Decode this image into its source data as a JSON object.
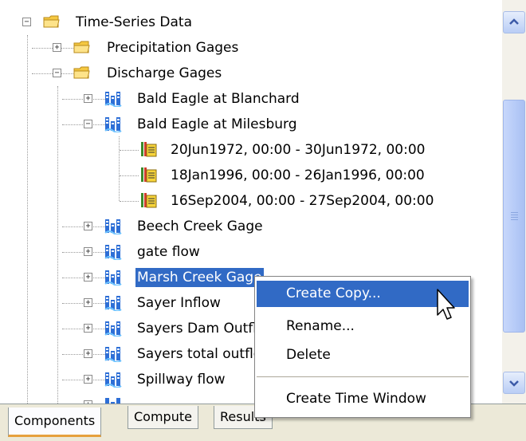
{
  "tree": {
    "root": {
      "label": "Time-Series Data",
      "expander": "−"
    },
    "precipitation": {
      "label": "Precipitation Gages",
      "expander": "+"
    },
    "discharge": {
      "label": "Discharge Gages",
      "expander": "−"
    },
    "gages": [
      {
        "label": "Bald Eagle at Blanchard",
        "expander": "+"
      },
      {
        "label": "Bald Eagle at Milesburg",
        "expander": "−"
      },
      {
        "label": "Beech Creek Gage",
        "expander": "+"
      },
      {
        "label": "gate flow",
        "expander": "+"
      },
      {
        "label": "Marsh Creek Gage",
        "expander": "+"
      },
      {
        "label": "Sayer Inflow",
        "expander": "+"
      },
      {
        "label": "Sayers Dam Outflow",
        "expander": "+"
      },
      {
        "label": "Sayers total outflow",
        "expander": "+"
      },
      {
        "label": "Spillway flow",
        "expander": "+"
      },
      {
        "label": "",
        "expander": "+"
      }
    ],
    "windows": [
      {
        "label": "20Jun1972, 00:00 - 30Jun1972, 00:00"
      },
      {
        "label": "18Jan1996, 00:00 - 26Jan1996, 00:00"
      },
      {
        "label": "16Sep2004, 00:00 - 27Sep2004, 00:00"
      }
    ]
  },
  "context_menu": {
    "items": [
      "Create Copy...",
      "Rename...",
      "Delete",
      "Create Time Window"
    ],
    "highlighted": "Create Copy..."
  },
  "tabs": [
    "Components",
    "Compute",
    "Results"
  ],
  "active_tab": "Components",
  "colors": {
    "selection": "#316ac5",
    "folder": "#f5c841",
    "active_tab_accent": "#e6a03d"
  },
  "icons": {
    "folder": "folder-icon",
    "gage": "gage-station-icon",
    "time_window": "time-window-icon"
  }
}
